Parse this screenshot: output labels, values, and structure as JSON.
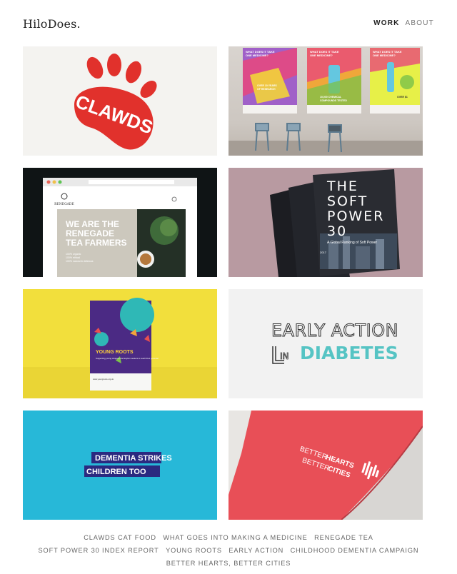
{
  "header": {
    "logo": "HiloDoes.",
    "nav": [
      {
        "label": "WORK",
        "active": true
      },
      {
        "label": "ABOUT",
        "active": false
      }
    ]
  },
  "tiles": {
    "clawds": {
      "logo_text": "CLAWDS",
      "color": "#e1312c"
    },
    "medicine": {
      "posters": [
        {
          "q1": "WHAT DOES IT TAKE",
          "q2": "TO MAKE",
          "q3": "ONE MEDICINE?",
          "stat1": "OVER 10 YEARS",
          "stat2": "OF RESEARCH",
          "stat3": "& DEVELOPMENT"
        },
        {
          "q1": "WHAT DOES IT TAKE",
          "q2": "TO MAKE",
          "q3": "ONE MEDICINE?",
          "stat1": "10,000 CHEMICAL",
          "stat2": "COMPOUNDS TESTED",
          "stat3": ""
        },
        {
          "q1": "WHAT DOES IT TAKE",
          "q2": "TO MAKE",
          "q3": "ONE MEDICINE?",
          "stat1": "OVER $1",
          "stat2": "BILLION",
          "stat3": "INVESTED"
        }
      ]
    },
    "renegade": {
      "brand": "RENEGADE",
      "headline1": "WE ARE THE",
      "headline2": "RENEGADE",
      "headline3": "TEA FARMERS",
      "bullets": [
        "100% organic",
        "100% ethical",
        "100% natural & delicious"
      ]
    },
    "softpower": {
      "line1": "THE",
      "line2": "SOFT",
      "line3": "POWER",
      "line4": "30",
      "subtitle": "A Global Ranking of Soft Power",
      "year": "2017"
    },
    "youngroots": {
      "title": "YOUNG ROOTS",
      "blurb": "Supporting young refugees and asylum seekers to reach their potential",
      "url": "www.youngroots.org.uk"
    },
    "earlyaction": {
      "line1": "EARLY ACTION",
      "line2a": "IN",
      "line2b": "DIABETES"
    },
    "dementia": {
      "line1": "DEMENTIA STRIKES",
      "line2": "CHILDREN TOO"
    },
    "hearts": {
      "line1a": "BETTER",
      "line1b": "HEARTS",
      "line2a": "BETTER",
      "line2b": "CITIES"
    }
  },
  "footer": {
    "links": [
      "CLAWDS CAT FOOD",
      "WHAT GOES INTO MAKING A MEDICINE",
      "RENEGADE TEA",
      "SOFT POWER 30 INDEX REPORT",
      "YOUNG ROOTS",
      "EARLY ACTION",
      "CHILDHOOD DEMENTIA CAMPAIGN",
      "BETTER HEARTS, BETTER CITIES"
    ]
  }
}
